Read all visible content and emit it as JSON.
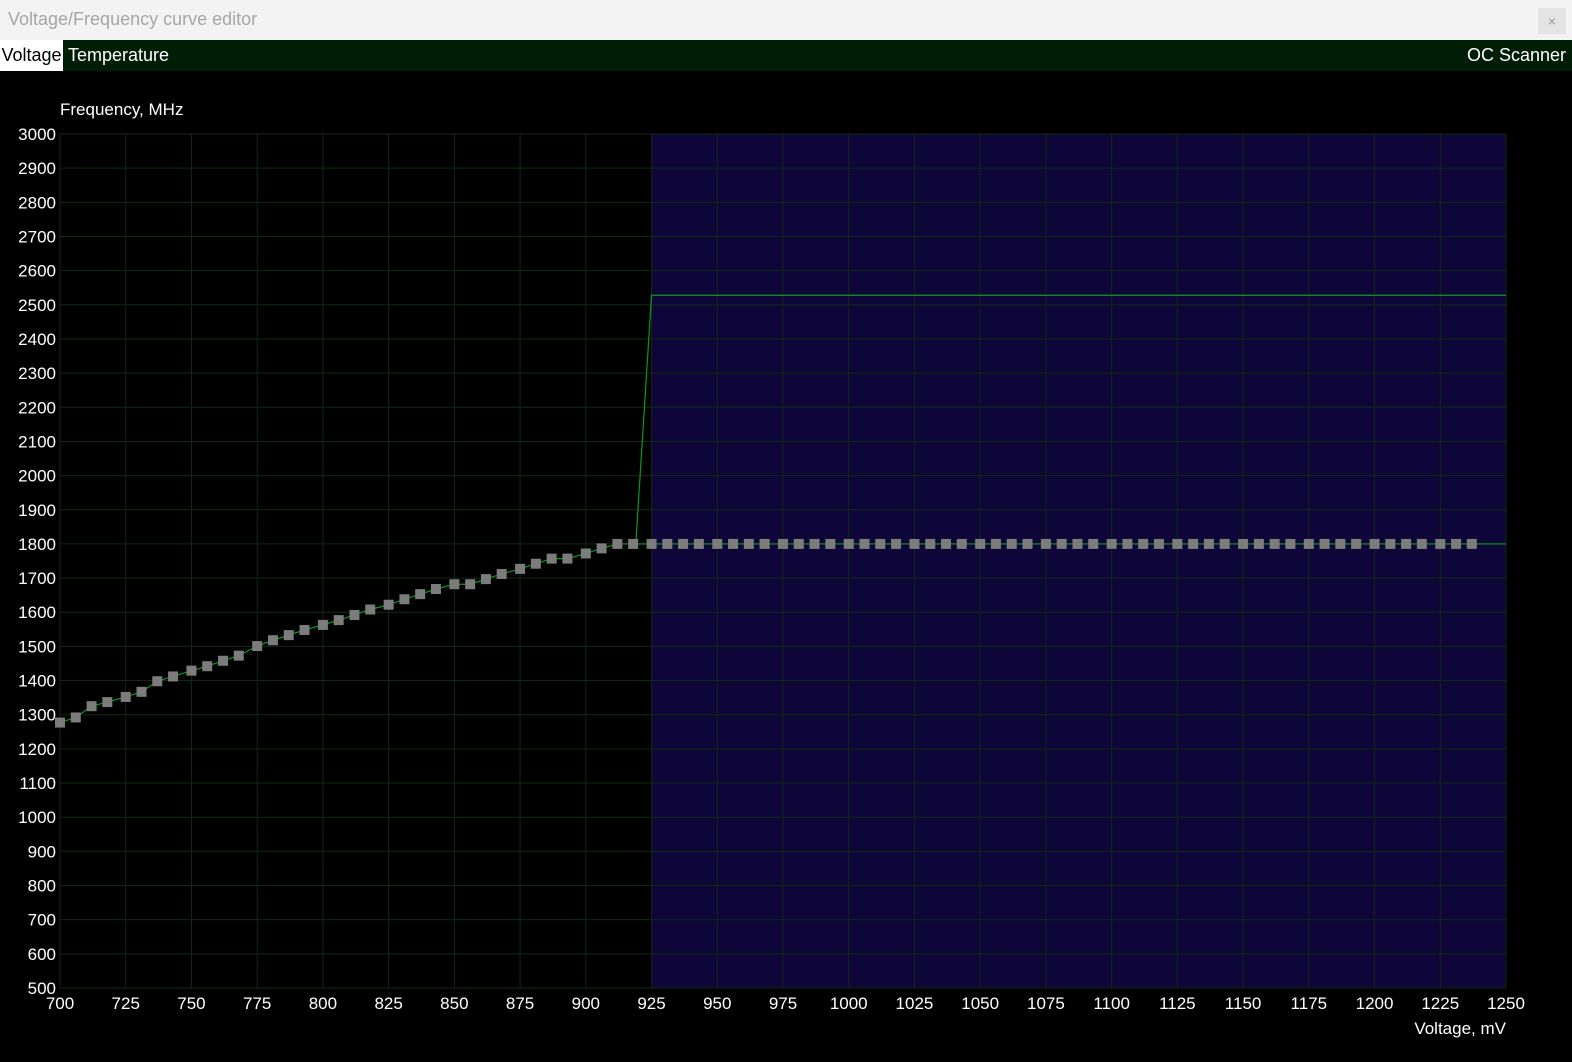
{
  "window": {
    "title": "Voltage/Frequency curve editor",
    "close_label": "×"
  },
  "tabs": [
    {
      "label": "Voltage",
      "active": true
    },
    {
      "label": "Temperature",
      "active": false
    }
  ],
  "toolbar": {
    "oc_scanner_label": "OC Scanner"
  },
  "colors": {
    "background": "#000000",
    "tab_bar": "#001d06",
    "locked_region": "#0e0638",
    "grid": "#0f2a12",
    "curve": "#0a9a1e",
    "point": "#7c7c7c"
  },
  "chart_data": {
    "type": "line",
    "ylabel": "Frequency, MHz",
    "xlabel": "Voltage, mV",
    "xlim": [
      700,
      1250
    ],
    "ylim": [
      500,
      3000
    ],
    "x_ticks": [
      700,
      725,
      750,
      775,
      800,
      825,
      850,
      875,
      900,
      925,
      950,
      975,
      1000,
      1025,
      1050,
      1075,
      1100,
      1125,
      1150,
      1175,
      1200,
      1225,
      1250
    ],
    "y_ticks": [
      3000,
      2900,
      2800,
      2700,
      2600,
      2500,
      2400,
      2300,
      2200,
      2100,
      2000,
      1900,
      1800,
      1700,
      1600,
      1500,
      1400,
      1300,
      1200,
      1100,
      1000,
      900,
      800,
      700,
      600,
      500
    ],
    "grid": true,
    "locked_region": {
      "x_start": 925,
      "x_end": 1250
    },
    "series": [
      {
        "points": [
          [
            700,
            1277
          ],
          [
            706,
            1292
          ],
          [
            712,
            1325
          ],
          [
            718,
            1337
          ],
          [
            725,
            1352
          ],
          [
            731,
            1367
          ],
          [
            737,
            1398
          ],
          [
            743,
            1412
          ],
          [
            750,
            1429
          ],
          [
            756,
            1442
          ],
          [
            762,
            1458
          ],
          [
            768,
            1473
          ],
          [
            775,
            1501
          ],
          [
            781,
            1518
          ],
          [
            787,
            1533
          ],
          [
            793,
            1548
          ],
          [
            800,
            1563
          ],
          [
            806,
            1577
          ],
          [
            812,
            1592
          ],
          [
            818,
            1608
          ],
          [
            825,
            1622
          ],
          [
            831,
            1638
          ],
          [
            837,
            1653
          ],
          [
            843,
            1668
          ],
          [
            850,
            1682
          ],
          [
            856,
            1682
          ],
          [
            862,
            1697
          ],
          [
            868,
            1712
          ],
          [
            875,
            1727
          ],
          [
            881,
            1742
          ],
          [
            887,
            1757
          ],
          [
            893,
            1757
          ],
          [
            900,
            1772
          ],
          [
            906,
            1787
          ],
          [
            912,
            1800
          ],
          [
            918,
            1800
          ],
          [
            925,
            1800
          ],
          [
            931,
            1800
          ],
          [
            937,
            1800
          ],
          [
            943,
            1800
          ],
          [
            950,
            1800
          ],
          [
            956,
            1800
          ],
          [
            962,
            1800
          ],
          [
            968,
            1800
          ],
          [
            975,
            1800
          ],
          [
            981,
            1800
          ],
          [
            987,
            1800
          ],
          [
            993,
            1800
          ],
          [
            1000,
            1800
          ],
          [
            1006,
            1800
          ],
          [
            1012,
            1800
          ],
          [
            1018,
            1800
          ],
          [
            1025,
            1800
          ],
          [
            1031,
            1800
          ],
          [
            1037,
            1800
          ],
          [
            1043,
            1800
          ],
          [
            1050,
            1800
          ],
          [
            1056,
            1800
          ],
          [
            1062,
            1800
          ],
          [
            1068,
            1800
          ],
          [
            1075,
            1800
          ],
          [
            1081,
            1800
          ],
          [
            1087,
            1800
          ],
          [
            1093,
            1800
          ],
          [
            1100,
            1800
          ],
          [
            1106,
            1800
          ],
          [
            1112,
            1800
          ],
          [
            1118,
            1800
          ],
          [
            1125,
            1800
          ],
          [
            1131,
            1800
          ],
          [
            1137,
            1800
          ],
          [
            1143,
            1800
          ],
          [
            1150,
            1800
          ],
          [
            1156,
            1800
          ],
          [
            1162,
            1800
          ],
          [
            1168,
            1800
          ],
          [
            1175,
            1800
          ],
          [
            1181,
            1800
          ],
          [
            1187,
            1800
          ],
          [
            1193,
            1800
          ],
          [
            1200,
            1800
          ],
          [
            1206,
            1800
          ],
          [
            1212,
            1800
          ],
          [
            1218,
            1800
          ],
          [
            1225,
            1800
          ],
          [
            1231,
            1800
          ],
          [
            1237,
            1800
          ]
        ]
      }
    ],
    "reference_line": [
      [
        919,
        1800
      ],
      [
        925,
        2528
      ],
      [
        1250,
        2528
      ]
    ]
  }
}
